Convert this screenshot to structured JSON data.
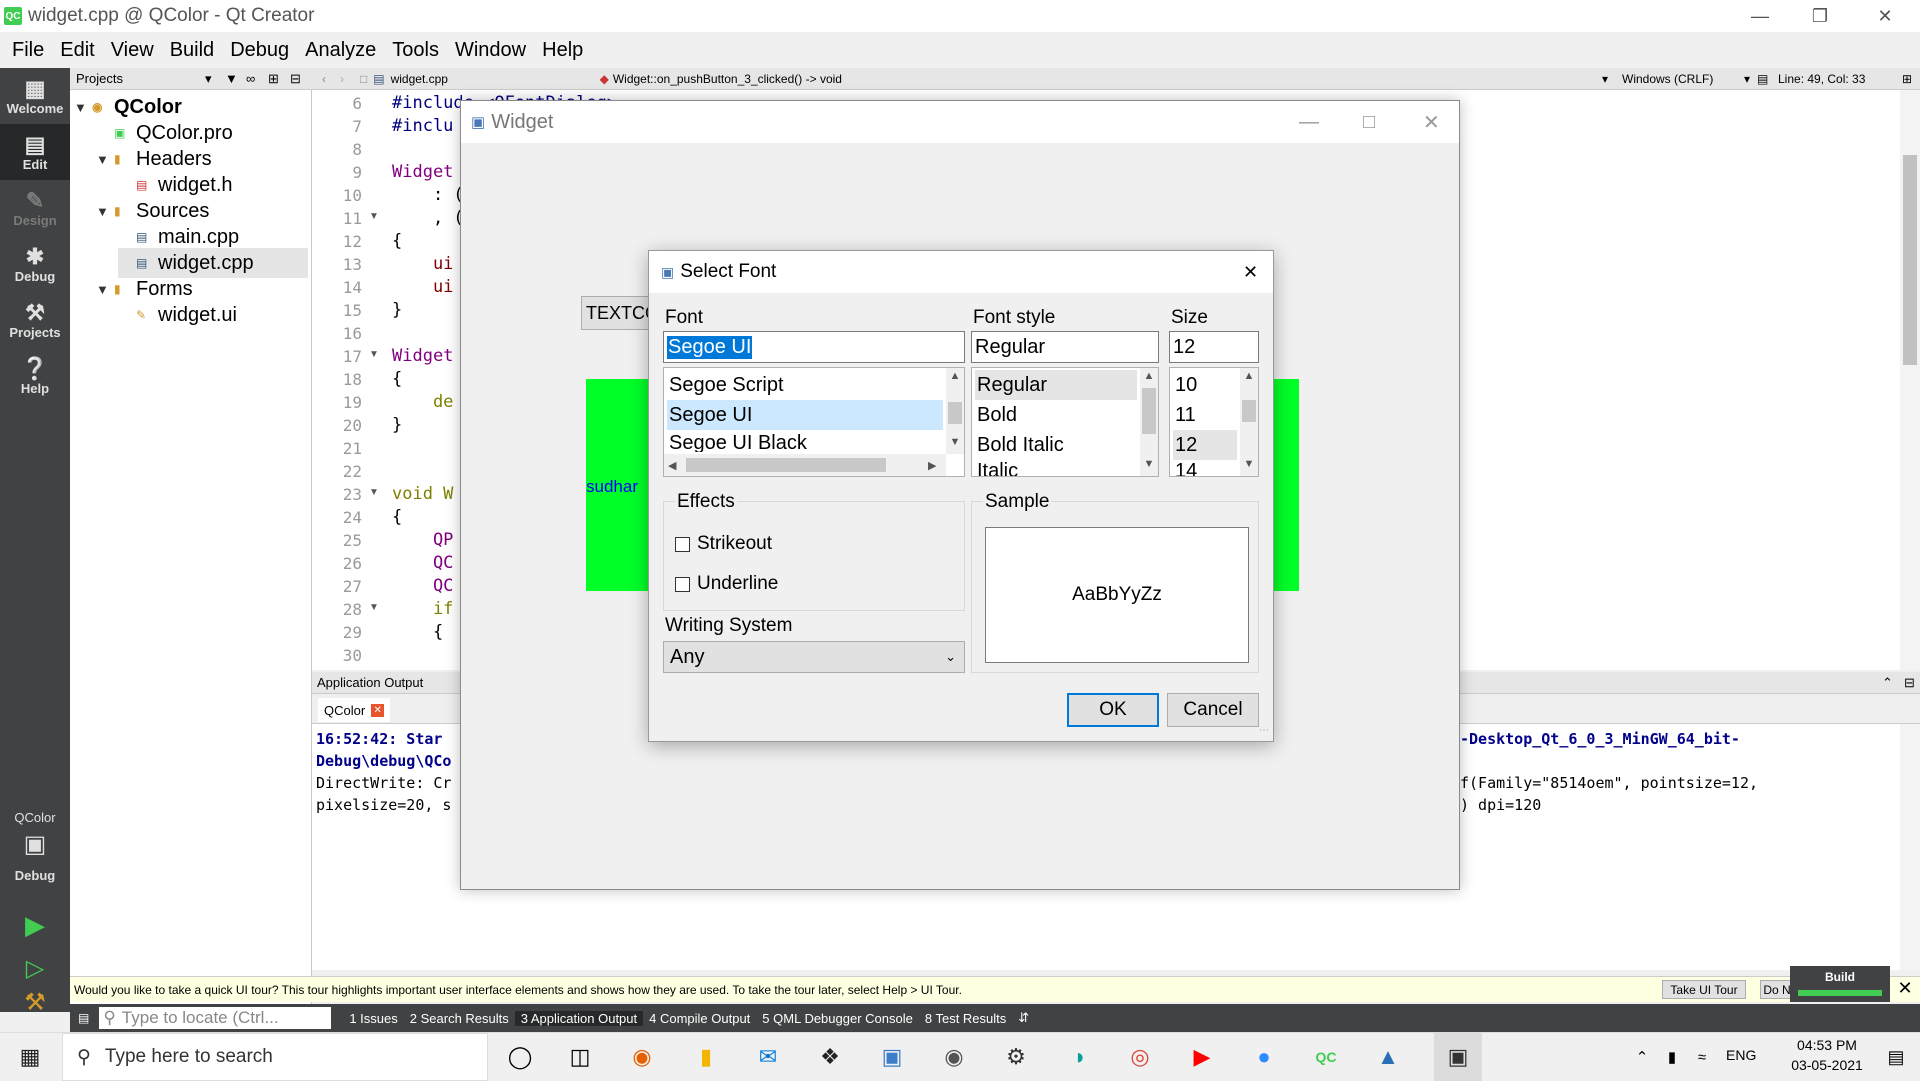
{
  "window": {
    "title": "widget.cpp @ QColor - Qt Creator"
  },
  "menu": [
    "File",
    "Edit",
    "View",
    "Build",
    "Debug",
    "Analyze",
    "Tools",
    "Window",
    "Help"
  ],
  "modes": {
    "welcome": "Welcome",
    "edit": "Edit",
    "design": "Design",
    "debug": "Debug",
    "projects": "Projects",
    "help": "Help"
  },
  "kit": {
    "name": "QColor",
    "mode": "Debug"
  },
  "projects": {
    "header": "Projects",
    "items": [
      "QColor",
      "QColor.pro",
      "Headers",
      "widget.h",
      "Sources",
      "main.cpp",
      "widget.cpp",
      "Forms",
      "widget.ui"
    ]
  },
  "editor": {
    "file": "widget.cpp",
    "function": "Widget::on_pushButton_3_clicked() -> void",
    "encoding": "Windows (CRLF)",
    "position": "Line: 49, Col: 33",
    "line_numbers": [
      "6",
      "7",
      "8",
      "9",
      "10",
      "11",
      "12",
      "13",
      "14",
      "15",
      "16",
      "17",
      "18",
      "19",
      "20",
      "21",
      "22",
      "23",
      "24",
      "25",
      "26",
      "27",
      "28",
      "29",
      "30"
    ],
    "code": [
      "#include <QFontDialog>",
      "#inclu",
      "",
      "Widget",
      "    : (",
      "    , (",
      "{",
      "    ui",
      "    ui",
      "}",
      "",
      "Widget",
      "{",
      "    de",
      "}",
      "",
      "",
      "void W",
      "{",
      "    QP",
      "    QC",
      "    QC",
      "    if",
      "    {",
      ""
    ]
  },
  "output": {
    "header": "Application Output",
    "tab": "QColor",
    "lines_left": [
      "16:52:42: Star",
      "Debug\\debug\\QCo",
      "DirectWrite: Cr",
      "pixelsize=20, s"
    ],
    "lines_right": [
      "-Desktop_Qt_6_0_3_MinGW_64_bit-",
      "",
      "f(Family=\"8514oem\", pointsize=12,",
      ") dpi=120"
    ]
  },
  "tour": {
    "text": "Would you like to take a quick UI tour? This tour highlights important user interface elements and shows how they are used. To take the tour later, select Help > UI Tour.",
    "take": "Take UI Tour",
    "dont": "Do N",
    "build": "Build"
  },
  "statusbar": {
    "locate_placeholder": "Type to locate (Ctrl...",
    "tabs": [
      "1  Issues",
      "2  Search Results",
      "3  Application Output",
      "4  Compile Output",
      "5  QML Debugger Console",
      "8  Test Results"
    ]
  },
  "widget": {
    "title": "Widget",
    "textco": "TEXTCO",
    "label": "sudhar"
  },
  "dialog": {
    "title": "Select Font",
    "font_label": "Font",
    "font_value": "Segoe UI",
    "fonts": [
      "Segoe Script",
      "Segoe UI",
      "Segoe UI Black"
    ],
    "style_label": "Font style",
    "style_value": "Regular",
    "styles": [
      "Regular",
      "Bold",
      "Bold Italic",
      "Italic"
    ],
    "size_label": "Size",
    "size_value": "12",
    "sizes": [
      "10",
      "11",
      "12",
      "14"
    ],
    "effects_label": "Effects",
    "strikeout": "Strikeout",
    "underline": "Underline",
    "sample_label": "Sample",
    "sample_text": "AaBbYyZz",
    "ws_label": "Writing System",
    "ws_value": "Any",
    "ok": "OK",
    "cancel": "Cancel"
  },
  "taskbar": {
    "search": "Type here to search",
    "lang": "ENG",
    "time": "04:53 PM",
    "date": "03-05-2021"
  },
  "colors": {
    "accent": "#0078d7",
    "green": "#00ff28",
    "modebar": "#404244",
    "qt": "#41cd52"
  }
}
